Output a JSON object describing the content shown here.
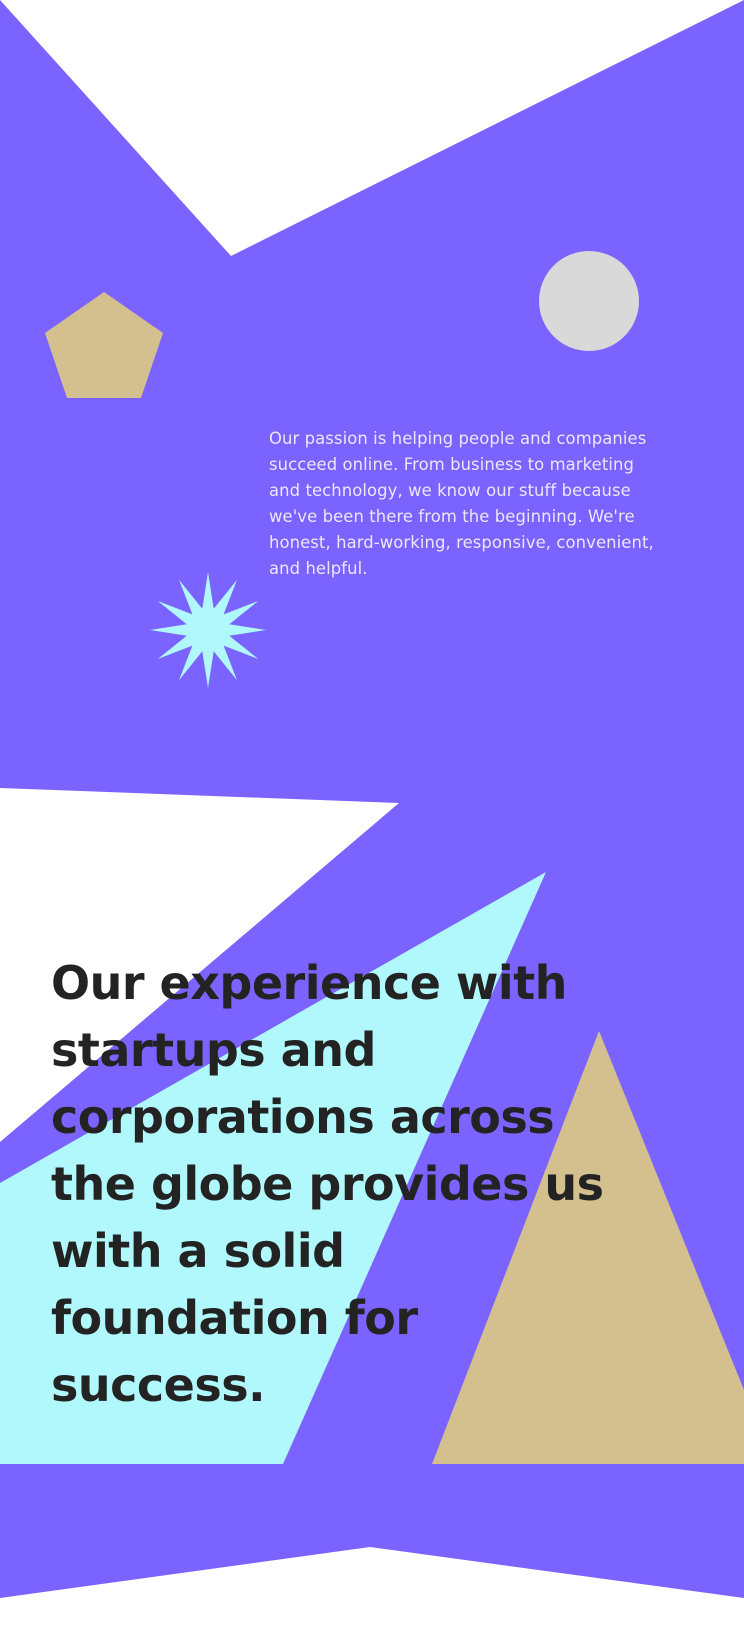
{
  "intro": {
    "passion_text": "Our passion is helping people and companies succeed online. From business to marketing and technology, we know our stuff because we've been there from the beginning. We're honest, hard-working, responsive, convenient, and helpful."
  },
  "headline": {
    "text": "Our experience with startups and corporations across the globe provides us with a solid foundation for success."
  },
  "colors": {
    "purple": "#7b63ff",
    "cyan": "#b0f8fc",
    "tan": "#d4bf8f",
    "grey": "#d9d9d9",
    "white": "#ffffff",
    "text_dark": "#232323",
    "text_light": "#ece6ff"
  }
}
